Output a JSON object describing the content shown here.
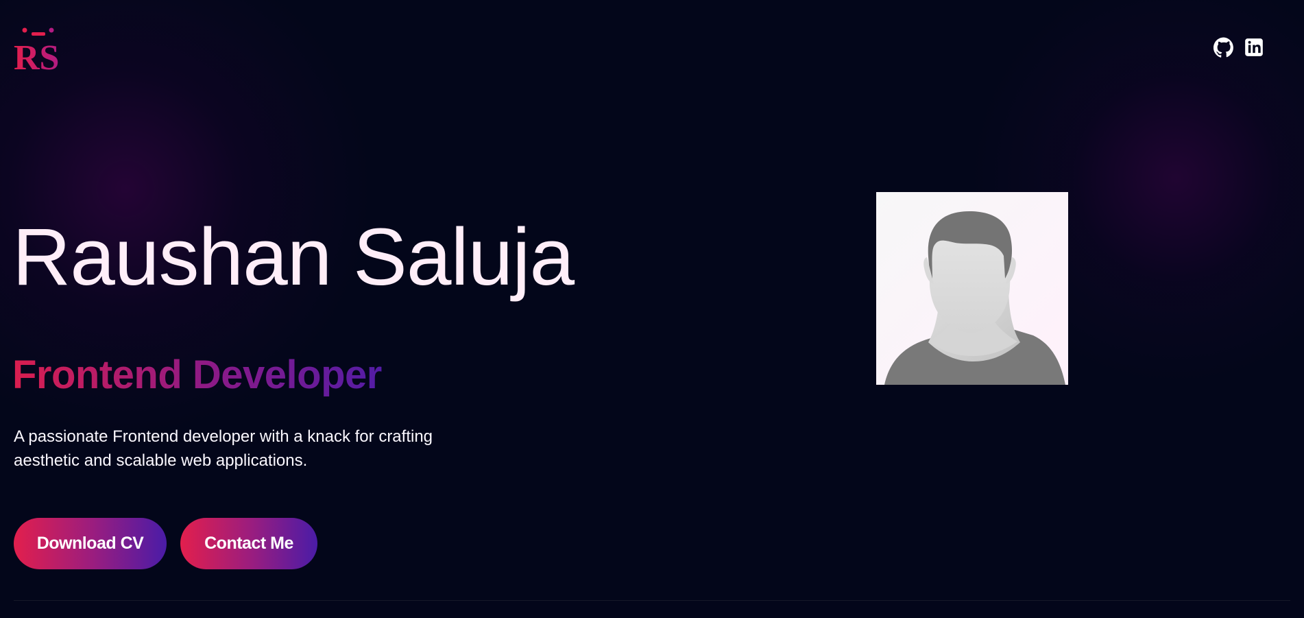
{
  "header": {
    "logo": {
      "text": "RS",
      "icon": "rs-monogram-logo"
    },
    "social_links": [
      {
        "name": "GitHub",
        "icon": "github-icon"
      },
      {
        "name": "LinkedIn",
        "icon": "linkedin-icon"
      }
    ]
  },
  "hero": {
    "name": "Raushan Saluja",
    "role": "Frontend Developer",
    "description": "A passionate Frontend developer with a knack for crafting aesthetic and scalable web applications.",
    "buttons": {
      "download_cv": "Download CV",
      "contact": "Contact Me"
    },
    "portrait": {
      "icon": "profile-avatar-placeholder"
    }
  },
  "colors": {
    "background": "#03061a",
    "name_text": "#ffeef8",
    "body_text": "#fbf8ff",
    "accent_start": "#e21f4d",
    "accent_middle": "#9a1d7f",
    "accent_end": "#4a1ca7",
    "portrait_background": "#f7f7f8"
  }
}
